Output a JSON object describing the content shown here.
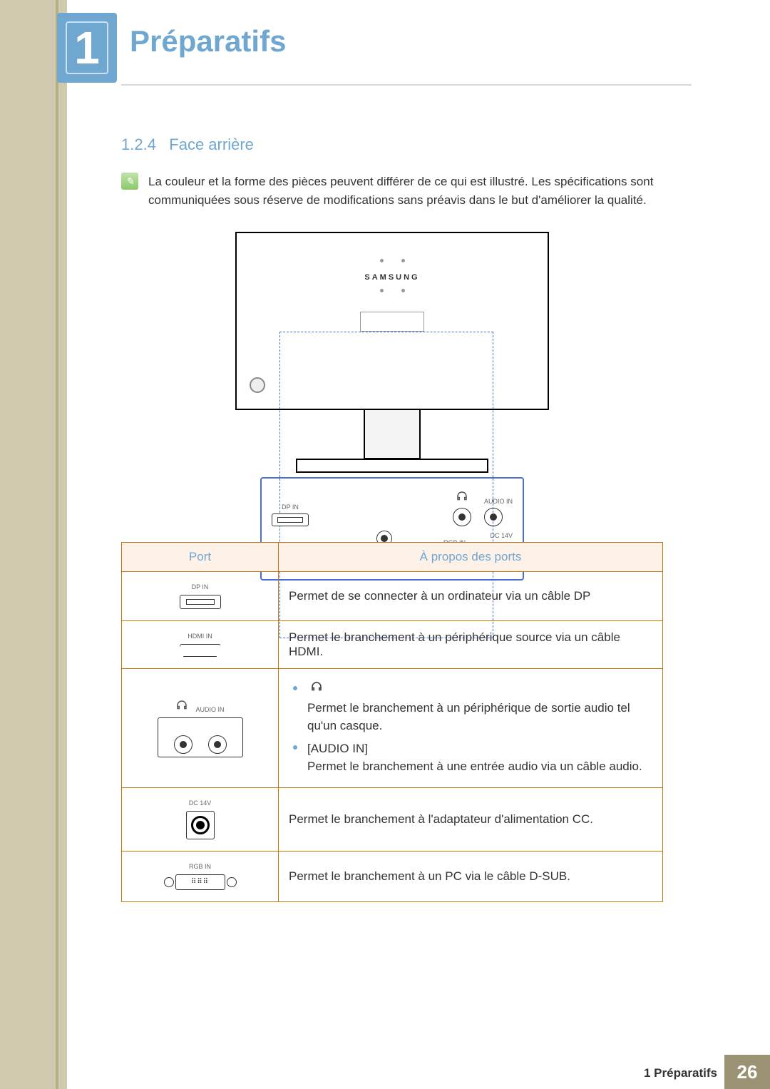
{
  "chapter": {
    "number": "1",
    "title": "Préparatifs"
  },
  "section": {
    "number": "1.2.4",
    "title": "Face arrière"
  },
  "note": "La couleur et la forme des pièces peuvent différer de ce qui est illustré. Les spécifications sont communiquées sous réserve de modifications sans préavis dans le but d'améliorer la qualité.",
  "diagram": {
    "brand": "SAMSUNG",
    "port_labels": {
      "dp": "DP IN",
      "hdmi": "HDMI IN",
      "audio": "AUDIO IN",
      "rgb": "RGB IN",
      "dc": "DC 14V"
    }
  },
  "table": {
    "headers": {
      "port": "Port",
      "about": "À propos des ports"
    },
    "rows": [
      {
        "label": "DP IN",
        "desc": "Permet de se connecter à un ordinateur via un câble DP"
      },
      {
        "label": "HDMI IN",
        "desc": "Permet le branchement à un périphérique source via un câble HDMI."
      },
      {
        "label": "AUDIO IN",
        "list_item1": "Permet le branchement à un périphérique de sortie audio tel qu'un casque.",
        "list_item2_title": "[AUDIO IN]",
        "list_item2_body": "Permet le branchement à une entrée audio via un câble audio."
      },
      {
        "label": "DC 14V",
        "desc": "Permet le branchement à l'adaptateur d'alimentation CC."
      },
      {
        "label": "RGB IN",
        "desc": "Permet le branchement à un PC via le câble D-SUB."
      }
    ]
  },
  "footer": {
    "label": "1 Préparatifs",
    "page": "26"
  }
}
